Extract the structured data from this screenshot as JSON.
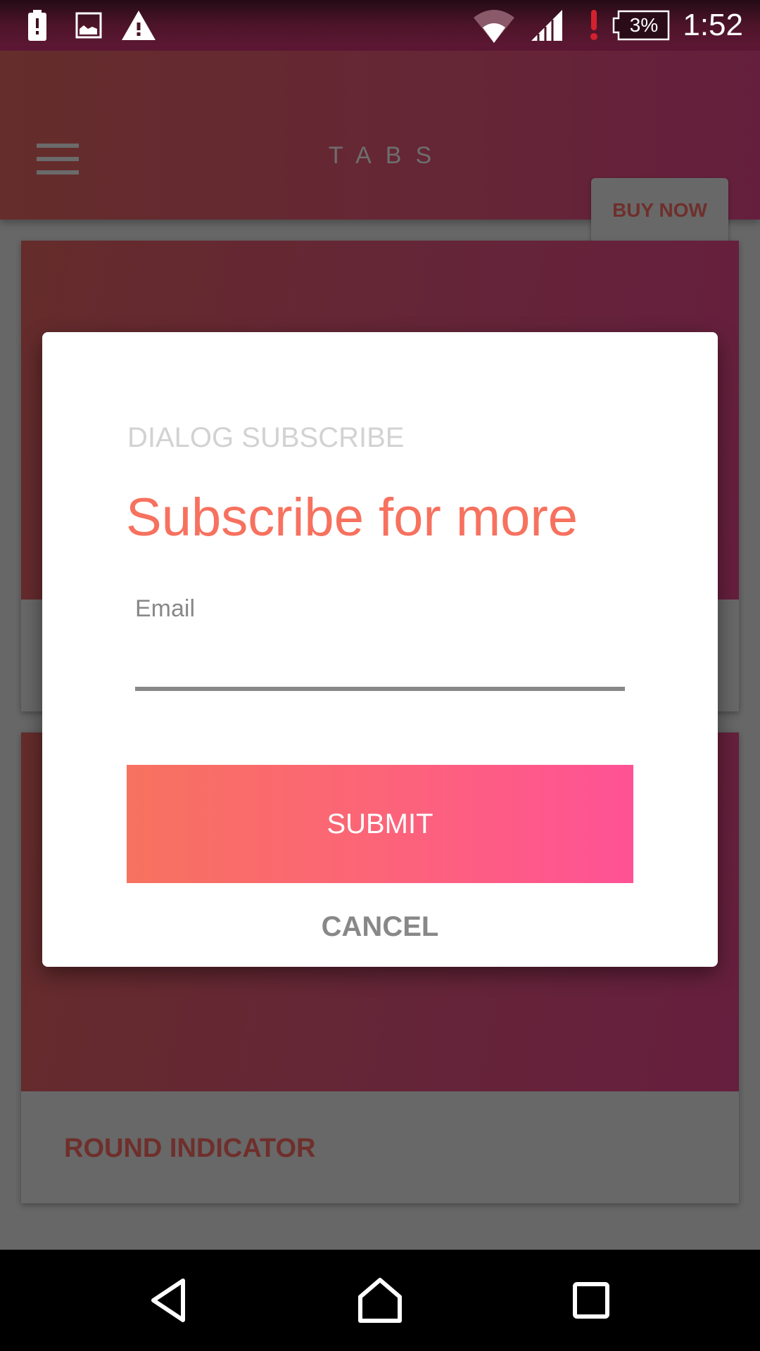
{
  "status_bar": {
    "left_icons": [
      "battery-alert-icon",
      "image-icon",
      "warning-icon"
    ],
    "right_icons": [
      "wifi-icon",
      "cell-signal-icon",
      "alert-icon"
    ],
    "battery_percent": "3%",
    "time": "1:52"
  },
  "app_bar": {
    "menu_icon": "hamburger-menu-icon",
    "title": "TABS",
    "buy_now_label": "BUY NOW"
  },
  "cards": [
    {
      "label": ""
    },
    {
      "label": "ROUND INDICATOR"
    }
  ],
  "dialog": {
    "overline": "DIALOG SUBSCRIBE",
    "title": "Subscribe for more",
    "email_label": "Email",
    "email_value": "",
    "email_placeholder": "",
    "submit_label": "SUBMIT",
    "cancel_label": "CANCEL",
    "colors": {
      "title": "#f7715f",
      "submit_gradient_start": "#f7725f",
      "submit_gradient_end": "#ff5296"
    }
  },
  "nav_bar": {
    "back_icon": "back-icon",
    "home_icon": "home-icon",
    "recents_icon": "recents-icon"
  }
}
